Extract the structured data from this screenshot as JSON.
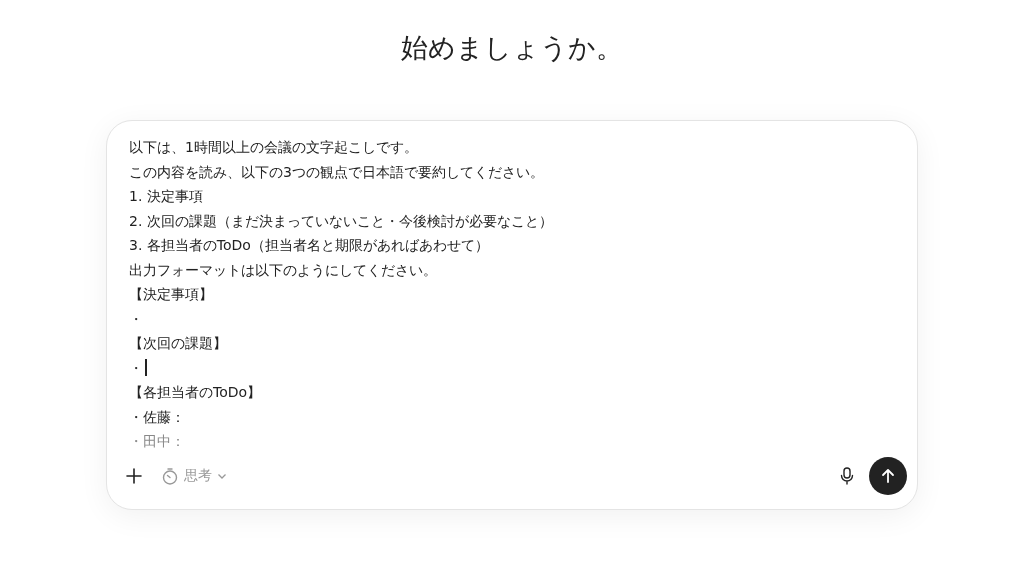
{
  "heading": "始めましょうか。",
  "prompt": {
    "lines": [
      {
        "text": "以下は、1時間以上の会議の文字起こしです。",
        "caret": false
      },
      {
        "text": "この内容を読み、以下の3つの観点で日本語で要約してください。",
        "caret": false
      },
      {
        "text": "1. 決定事項",
        "caret": false
      },
      {
        "text": "2. 次回の課題（まだ決まっていないこと・今後検討が必要なこと）",
        "caret": false
      },
      {
        "text": "3. 各担当者のToDo（担当者名と期限があればあわせて）",
        "caret": false
      },
      {
        "text": "出力フォーマットは以下のようにしてください。",
        "caret": false
      },
      {
        "text": "【決定事項】",
        "caret": false
      },
      {
        "text": "・",
        "caret": false
      },
      {
        "text": "【次回の課題】",
        "caret": false
      },
      {
        "text": "・",
        "caret": true
      },
      {
        "text": "【各担当者のToDo】",
        "caret": false
      },
      {
        "text": "・佐藤：",
        "caret": false
      },
      {
        "text": "・田中：",
        "caret": false
      }
    ]
  },
  "toolbar": {
    "mode_label": "思考"
  }
}
